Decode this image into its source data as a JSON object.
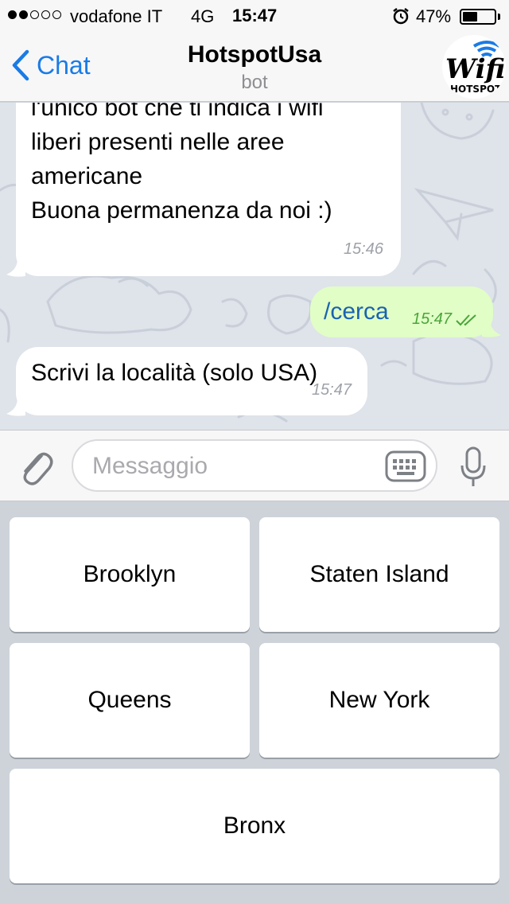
{
  "status_bar": {
    "signal_dots": [
      true,
      true,
      false,
      false,
      false
    ],
    "carrier": "vodafone IT",
    "network": "4G",
    "time": "15:47",
    "battery_percent": "47%",
    "battery_level": 0.47
  },
  "nav": {
    "back_label": "Chat",
    "title": "HotspotUsa",
    "subtitle": "bot",
    "avatar": {
      "line1": "Wifi",
      "line2": "HOTSPOT"
    }
  },
  "messages": [
    {
      "direction": "in",
      "lines": [
        "l'unico bot che ti indica i wifi",
        "liberi presenti nelle aree",
        "americane",
        "Buona permanenza da noi :)"
      ],
      "time": "15:46"
    },
    {
      "direction": "out",
      "text": "/cerca",
      "time": "15:47",
      "status": "read"
    },
    {
      "direction": "in",
      "text": "Scrivi la località (solo USA)",
      "time": "15:47"
    }
  ],
  "input": {
    "placeholder": "Messaggio",
    "value": ""
  },
  "keyboard": {
    "buttons": [
      "Brooklyn",
      "Staten Island",
      "Queens",
      "New York",
      "Bronx"
    ]
  },
  "colors": {
    "accent": "#1a7be6",
    "outgoing_bubble": "#e1fec6",
    "read_ticks": "#4aa53b",
    "command_text": "#1a63b0"
  }
}
